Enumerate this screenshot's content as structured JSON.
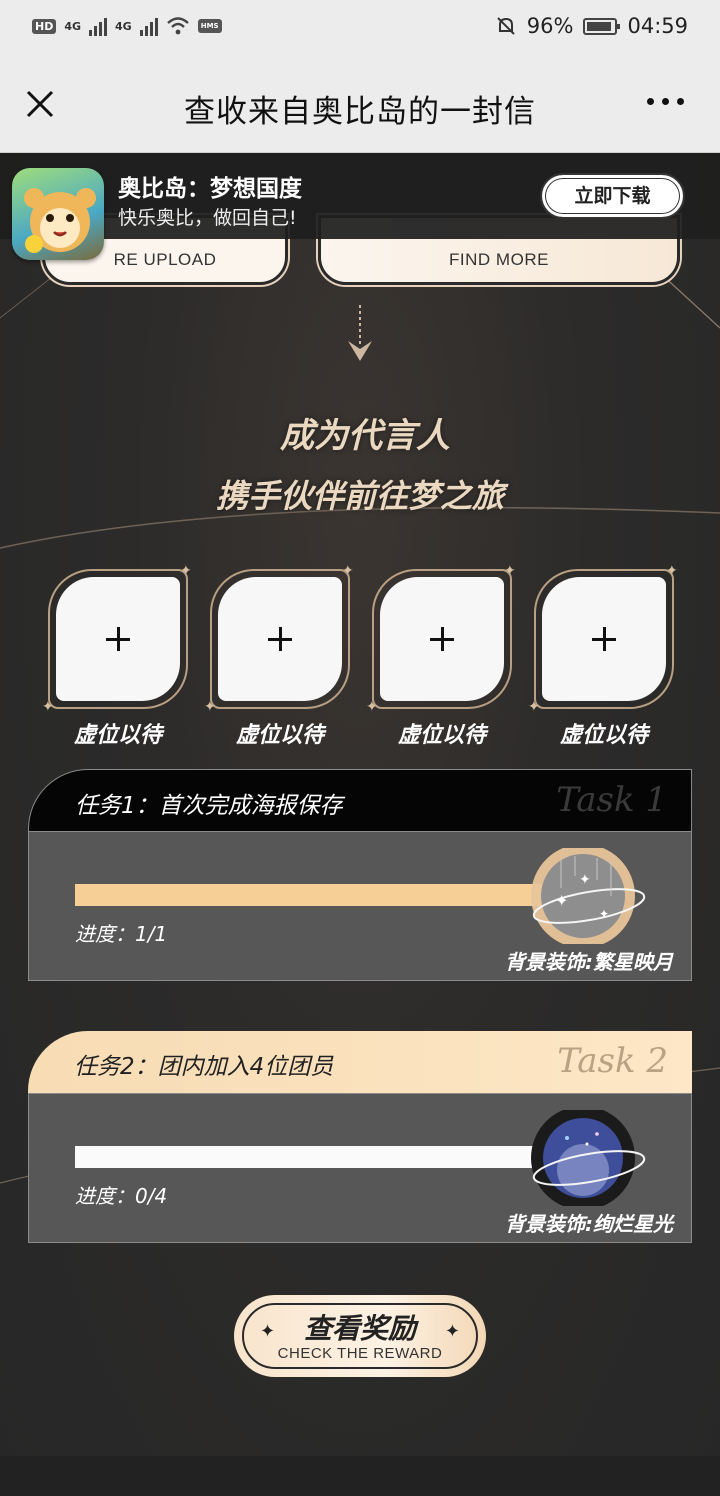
{
  "status_bar": {
    "hd": "HD",
    "net1": "4G",
    "net2": "4G",
    "hms": "HMS",
    "battery_pct": "96%",
    "time": "04:59"
  },
  "titlebar": {
    "title": "查收来自奥比岛的一封信"
  },
  "top_buttons": {
    "left_sub": "RE UPLOAD",
    "right_sub": "FIND MORE"
  },
  "app_banner": {
    "name": "奥比岛：梦想国度",
    "slogan": "快乐奥比，做回自己!",
    "download": "立即下载"
  },
  "headline": {
    "line1": "成为代言人",
    "line2": "携手伙伴前往梦之旅"
  },
  "slots": [
    {
      "label": "虚位以待"
    },
    {
      "label": "虚位以待"
    },
    {
      "label": "虚位以待"
    },
    {
      "label": "虚位以待"
    }
  ],
  "tasks": [
    {
      "title": "任务1：首次完成海报保存",
      "tag": "Task 1",
      "progress_text": "进度：1/1",
      "progress": 1.0,
      "reward": "背景装饰:繁星映月"
    },
    {
      "title": "任务2：团内加入4位团员",
      "tag": "Task 2",
      "progress_text": "进度：0/4",
      "progress": 0.0,
      "reward": "背景装饰:绚烂星光"
    }
  ],
  "reward_button": {
    "title": "查看奖励",
    "subtitle": "CHECK THE REWARD"
  },
  "colors": {
    "accent_gold": "#f6cf97",
    "frame_gold": "#b9a083",
    "bg_dark": "#2b2a2a"
  }
}
